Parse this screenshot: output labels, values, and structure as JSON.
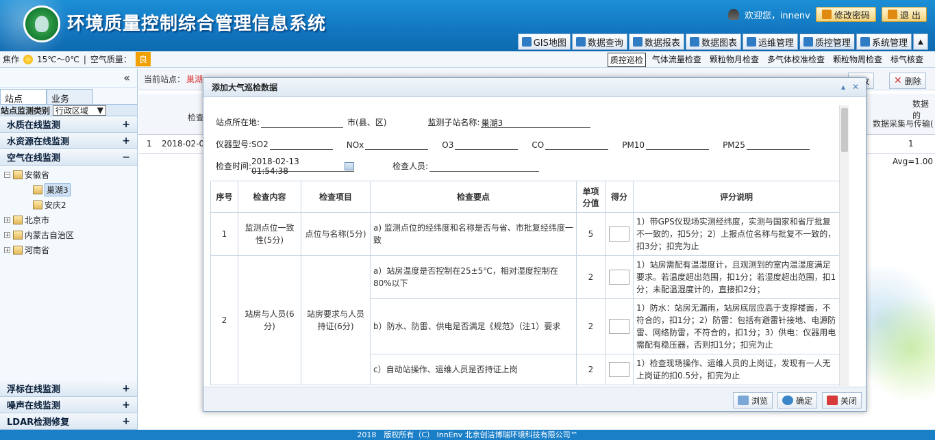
{
  "header": {
    "title": "环境质量控制综合管理信息系统",
    "welcome": "欢迎您，innenv",
    "change_password": "修改密码",
    "logout": "退 出"
  },
  "nav": [
    "GIS地图",
    "数据查询",
    "数据报表",
    "数据图表",
    "运维管理",
    "质控管理",
    "系统管理"
  ],
  "nav_active": "质控管理",
  "weather": {
    "city": "焦作",
    "temp": "15℃～0℃",
    "aq_label": "空气质量：",
    "aq_value": "良"
  },
  "subnav": [
    "质控巡检",
    "气体流量检查",
    "颗粒物月检查",
    "多气体校准检查",
    "颗粒物周检查",
    "标气核查"
  ],
  "subnav_active": "质控巡检",
  "sidebar": {
    "tabs": [
      "站点",
      "业务"
    ],
    "site_type_label": "站点监测类别",
    "region_select": "行政区域",
    "accordion_top": [
      {
        "label": "水质在线监测",
        "sign": "+"
      },
      {
        "label": "水资源在线监测",
        "sign": "+"
      },
      {
        "label": "空气在线监测",
        "sign": "−"
      }
    ],
    "tree": [
      {
        "label": "安徽省",
        "level": 0,
        "pm": "−"
      },
      {
        "label": "巢湖3",
        "level": 1,
        "pm": ""
      },
      {
        "label": "安庆2",
        "level": 1,
        "pm": ""
      },
      {
        "label": "北京市",
        "level": 0,
        "pm": "+"
      },
      {
        "label": "内蒙古自治区",
        "level": 0,
        "pm": "+"
      },
      {
        "label": "河南省",
        "level": 0,
        "pm": "+"
      }
    ],
    "accordion_bottom": [
      {
        "label": "浮标在线监测",
        "sign": "+"
      },
      {
        "label": "噪声在线监测",
        "sign": "+"
      },
      {
        "label": "LDAR检测修复",
        "sign": "+"
      }
    ]
  },
  "main": {
    "current_station_label": "当前站点：",
    "current_station_value": "巢湖",
    "modify": "修改",
    "delete": "删除",
    "grid_header_check": "检查",
    "grid_header_data": "数据的",
    "grid_header_collect": "数据采集与传输(",
    "row_no": "1",
    "row_date": "2018-02-0",
    "row_value": "1",
    "avg": "Avg=1.00"
  },
  "modal": {
    "title": "添加大气巡检数据",
    "station_loc_label": "站点所在地:",
    "city_label": "市(县、区)",
    "sub_station_label": "监测子站名称:",
    "sub_station_value": "巢湖3",
    "instrument_label": "仪器型号:SO2",
    "nox": "NOx",
    "o3": "O3",
    "co": "CO",
    "pm10": "PM10",
    "pm25": "PM25",
    "check_time_label": "检查时间:",
    "check_time_value": "2018-02-13 01:54:38",
    "inspector_label": "检查人员:",
    "table_headers": [
      "序号",
      "检查内容",
      "检查项目",
      "检查要点",
      "单项分值",
      "得分",
      "评分说明"
    ],
    "rows": [
      {
        "no": "1",
        "content": "监测点位一致性(5分)",
        "item": "点位与名称(5分)",
        "point": "a) 监测点位的经纬度和名称是否与省、市批复经纬度一致",
        "score": "5",
        "desc": "1）带GPS仪现场实测经纬度，实测与国家和省厅批复不一致的，扣5分；2）上报点位名称与批复不一致的，扣3分；扣完为止"
      },
      {
        "no": "2",
        "content": "站房与人员(6分)",
        "item": "站房要求与人员持证(6分)",
        "point": "a）站房温度是否控制在25±5℃，相对湿度控制在80%以下",
        "score": "2",
        "desc": "1）站房需配有温湿度计，且观测到的室内温湿度满足要求。若温度超出范围，扣1分；若湿度超出范围，扣1分；未配温湿度计的，直接扣2分；"
      },
      {
        "point": "b）防水、防雷、供电是否满足《规范》（注1）要求",
        "score": "2",
        "desc": "1）防水：站房无漏雨，站房底层应高于支撑楼面，不符合的，扣1分；2）防雷：包括有避雷针接地、电源防雷、网络防雷，不符合的，扣1分；3）供电：仪器用电需配有稳压器，否则扣1分；扣完为止"
      },
      {
        "point": "c）自动站操作、运维人员是否持证上岗",
        "score": "2",
        "desc": "1）检查现场操作、运维人员的上岗证，发现有一人无上岗证的扣0.5分，扣完为止"
      }
    ],
    "btn_browse": "浏览",
    "btn_ok": "确定",
    "btn_close": "关闭"
  },
  "footer": "2018　版权所有（C） InnEnv 北京创洁博瑞环境科技有限公司™",
  "colors": {
    "header_bg": "#1276bf",
    "accent": "#f0a000",
    "footer_bg": "#1b7fc8"
  }
}
